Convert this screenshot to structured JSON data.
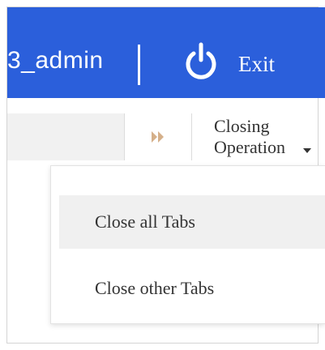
{
  "header": {
    "username": "3_admin",
    "exit_label": "Exit",
    "background_color": "#2b5fdb"
  },
  "toolbar": {
    "expand_icon": "double-chevron-right-icon",
    "closing_operation_line1": "Closing",
    "closing_operation_line2": "Operation"
  },
  "menu": {
    "items": [
      {
        "label": "Close all Tabs",
        "highlighted": true
      },
      {
        "label": "Close other Tabs",
        "highlighted": false
      }
    ]
  }
}
